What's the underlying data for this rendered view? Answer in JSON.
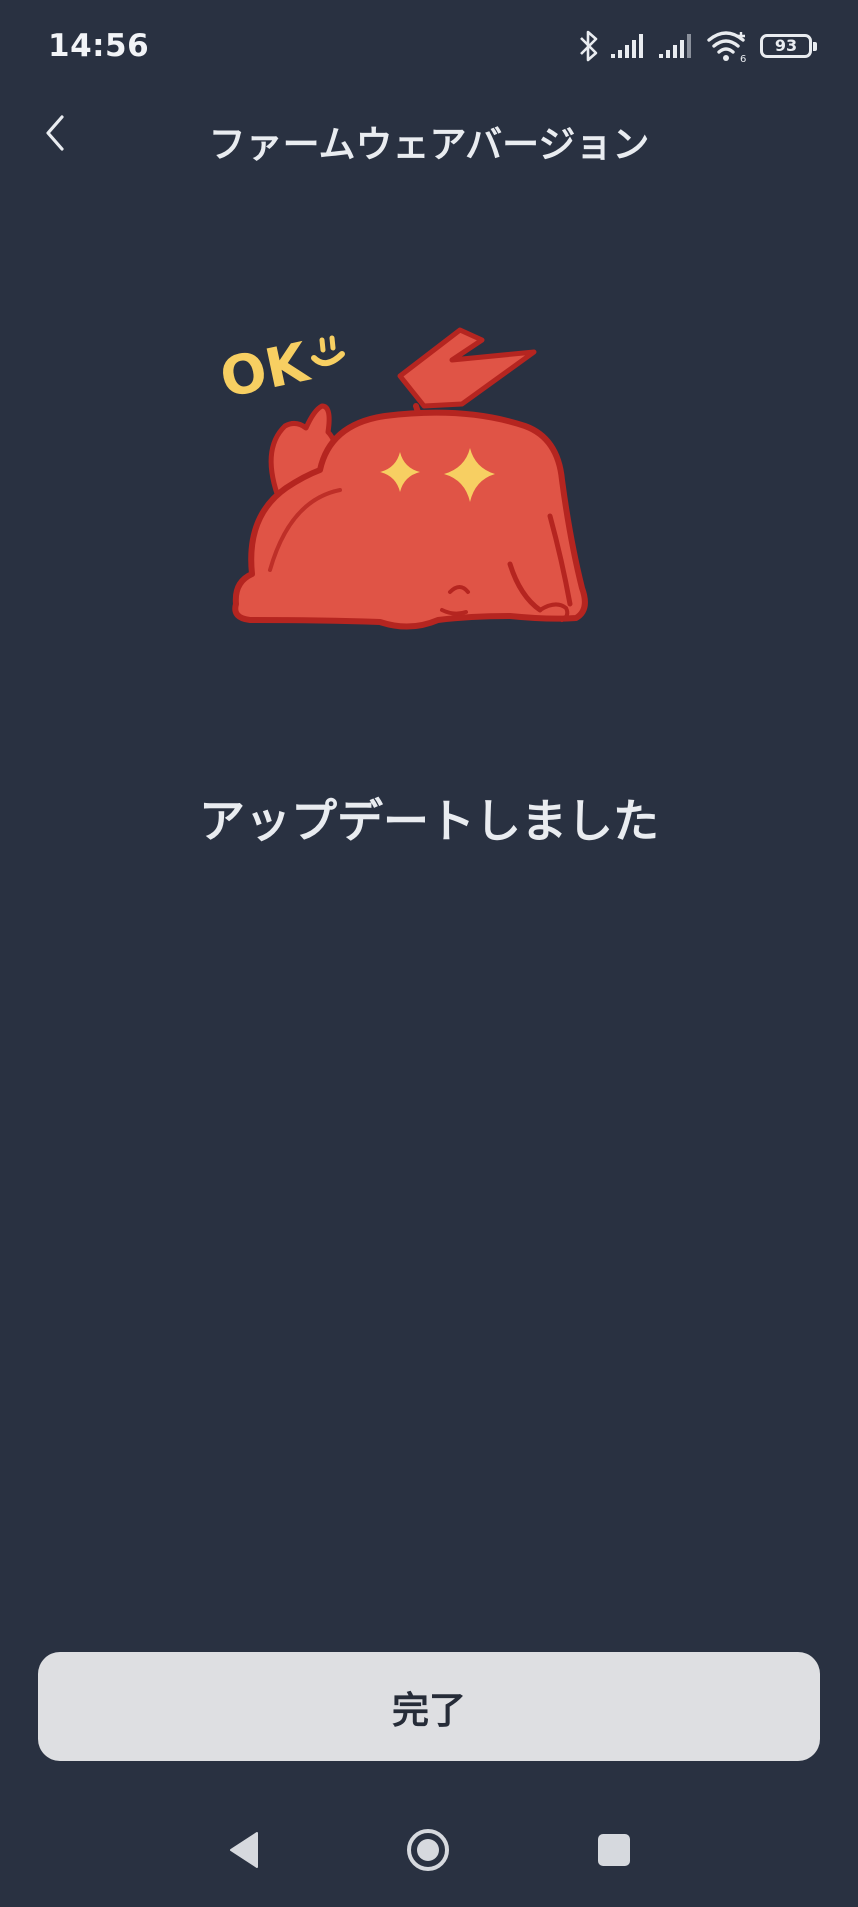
{
  "status_bar": {
    "time": "14:56",
    "battery_level": "93",
    "icons": [
      "bluetooth-icon",
      "signal-icon",
      "signal-icon",
      "wifi-icon",
      "battery-icon"
    ]
  },
  "header": {
    "title": "ファームウェアバージョン",
    "back_icon": "chevron-left-icon"
  },
  "illustration": {
    "ok_text": "OK"
  },
  "main": {
    "message": "アップデートしました"
  },
  "footer": {
    "done_label": "完了"
  },
  "nav": {
    "items": [
      "back-triangle-icon",
      "home-circle-icon",
      "recents-square-icon"
    ]
  },
  "colors": {
    "background": "#293141",
    "text": "#e9ecf0",
    "button_bg": "#dedfe2",
    "mascot_red": "#e05446",
    "mascot_outline": "#b52520",
    "accent_yellow": "#f7cf62"
  }
}
